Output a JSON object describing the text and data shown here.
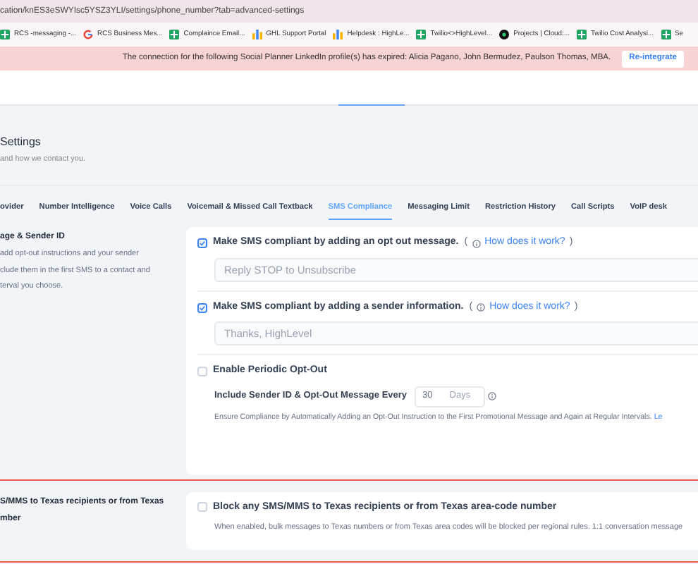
{
  "address_bar": {
    "url": "cation/knES3eSWYIsc5YSZ3YLI/settings/phone_number?tab=advanced-settings"
  },
  "bookmarks": [
    {
      "label": "RCS -messaging -...",
      "kind": "sheet"
    },
    {
      "label": "RCS Business Mes...",
      "kind": "google"
    },
    {
      "label": "Complaince Email...",
      "kind": "sheet"
    },
    {
      "label": "GHL Support Portal",
      "kind": "chart"
    },
    {
      "label": "Helpdesk : HighLe...",
      "kind": "chart"
    },
    {
      "label": "Twilio<>HighLevel...",
      "kind": "sheet"
    },
    {
      "label": "Projects | Cloud:...",
      "kind": "dark"
    },
    {
      "label": "Twilio Cost Analysi...",
      "kind": "sheet"
    },
    {
      "label": "Se",
      "kind": "sheet"
    }
  ],
  "banner": {
    "message": "The connection for the following Social Planner LinkedIn profile(s) has expired: Alicia Pagano, John Bermudez, Paulson Thomas, MBA.",
    "button": "Re-integrate"
  },
  "page": {
    "title": "Settings",
    "subtitle": "and how we contact you."
  },
  "tabs": [
    {
      "label": "ovider",
      "selected": false
    },
    {
      "label": "Number Intelligence",
      "selected": false
    },
    {
      "label": "Voice Calls",
      "selected": false
    },
    {
      "label": "Voicemail & Missed Call Textback",
      "selected": false
    },
    {
      "label": "SMS Compliance",
      "selected": true
    },
    {
      "label": "Messaging Limit",
      "selected": false
    },
    {
      "label": "Restriction History",
      "selected": false
    },
    {
      "label": "Call Scripts",
      "selected": false
    },
    {
      "label": "VoIP desk",
      "selected": false
    }
  ],
  "sections": [
    {
      "heading": "age & Sender ID",
      "description": [
        "add opt-out instructions and your sender",
        "clude them in the first SMS to a contact and",
        "terval you choose."
      ],
      "highlighted": false,
      "items": [
        {
          "kind": "text",
          "label": "Make SMS compliant by adding an opt out message.",
          "checked": true,
          "paren_open": "(",
          "link": "How does it work?",
          "paren_close": ")",
          "placeholder": "Reply STOP to Unsubscribe"
        },
        {
          "kind": "text",
          "label": "Make SMS compliant by adding a sender information.",
          "checked": true,
          "paren_open": "(",
          "link": "How does it work?",
          "paren_close": ")",
          "placeholder": "Thanks, HighLevel"
        },
        {
          "kind": "interval",
          "label": "Enable Periodic Opt-Out",
          "checked": false,
          "interval_label": "Include Sender ID & Opt-Out Message Every",
          "value": "30",
          "unit": "Days",
          "note": "Ensure Compliance by Automatically Adding an Opt-Out Instruction to the First Promotional Message and Again at Regular Intervals.",
          "note_link": "Le"
        }
      ]
    },
    {
      "heading": "S/MMS to Texas recipients or from Texas",
      "heading_cont": "mber",
      "highlighted": true,
      "items": [
        {
          "kind": "plain",
          "label": "Block any SMS/MMS to Texas recipients or from Texas area-code number",
          "checked": false,
          "note": "When enabled, bulk messages to Texas numbers or from Texas area codes will be blocked per regional rules. 1:1 conversation message"
        }
      ]
    }
  ]
}
